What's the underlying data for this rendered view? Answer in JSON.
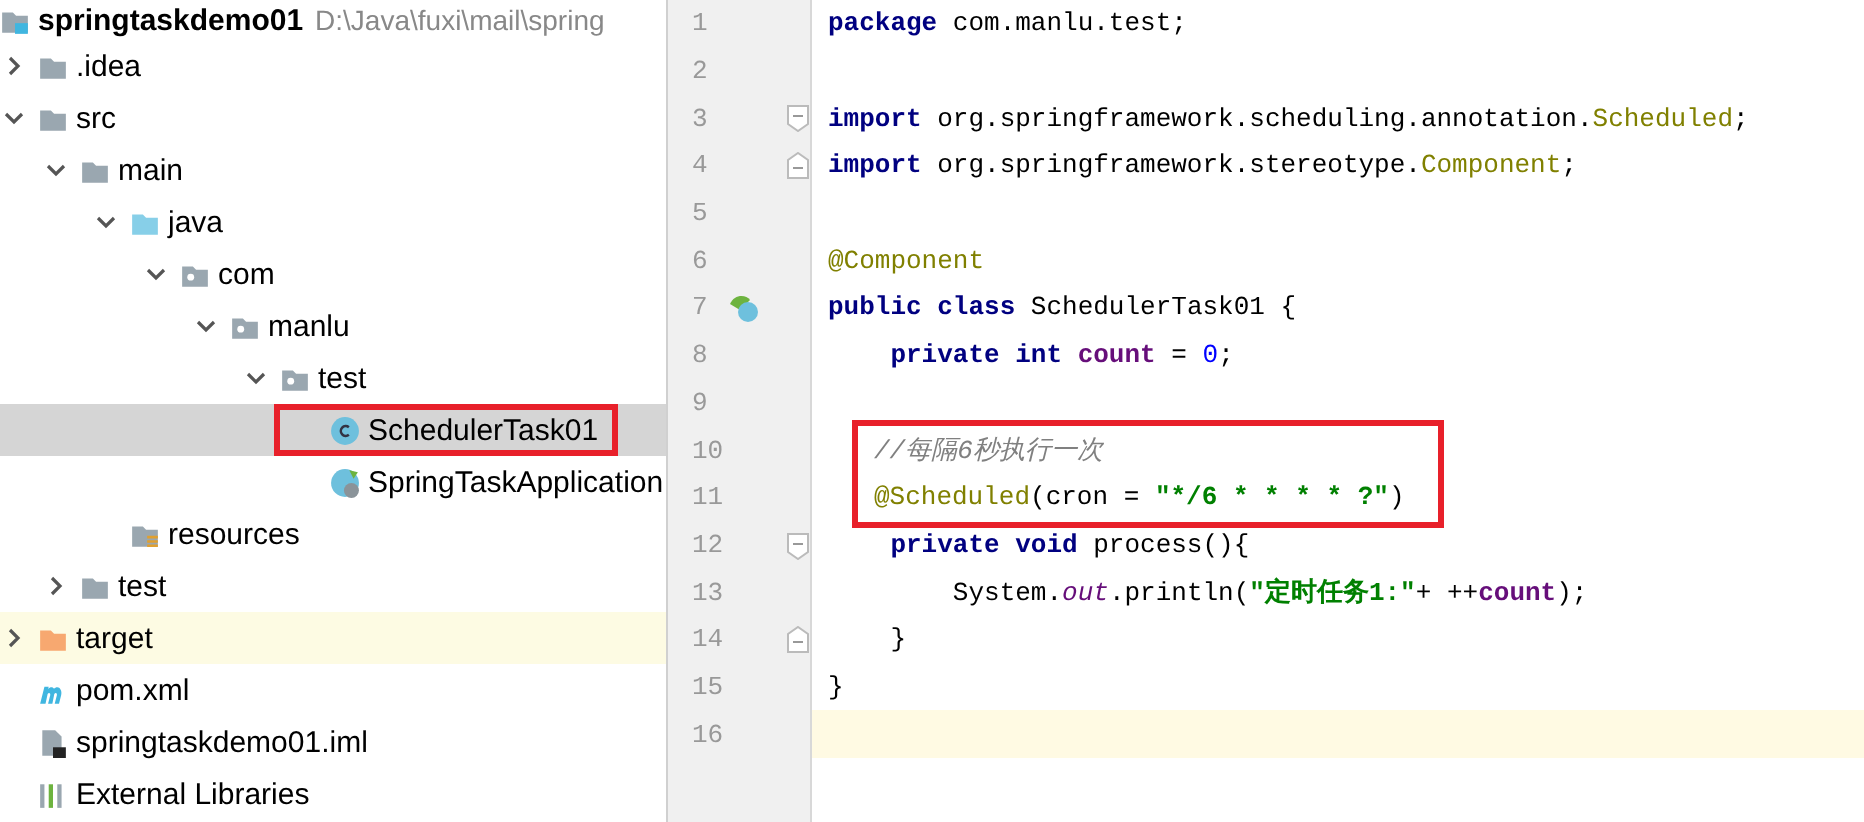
{
  "project_tree": {
    "root": {
      "name": "springtaskdemo01",
      "path": "D:\\Java\\fuxi\\mail\\spring",
      "kind": "module"
    },
    "items": [
      {
        "name": ".idea",
        "kind": "folder",
        "expanded": false,
        "selected": false
      },
      {
        "name": "src",
        "kind": "folder",
        "expanded": true,
        "selected": false,
        "children": [
          {
            "name": "main",
            "kind": "folder",
            "expanded": true,
            "selected": false,
            "children": [
              {
                "name": "java",
                "kind": "source-folder",
                "expanded": true,
                "selected": false,
                "children": [
                  {
                    "name": "com",
                    "kind": "package",
                    "expanded": true,
                    "selected": false,
                    "children": [
                      {
                        "name": "manlu",
                        "kind": "package",
                        "expanded": true,
                        "selected": false,
                        "children": [
                          {
                            "name": "test",
                            "kind": "package",
                            "expanded": true,
                            "selected": false,
                            "children": [
                              {
                                "name": "SchedulerTask01",
                                "kind": "class",
                                "selected": true,
                                "boxed": true
                              },
                              {
                                "name": "SpringTaskApplication",
                                "kind": "spring-class",
                                "selected": false
                              }
                            ]
                          }
                        ]
                      }
                    ]
                  }
                ]
              },
              {
                "name": "resources",
                "kind": "resources",
                "selected": false
              }
            ]
          },
          {
            "name": "test",
            "kind": "folder",
            "expanded": false,
            "selected": false
          }
        ]
      },
      {
        "name": "target",
        "kind": "excluded-folder",
        "expanded": false,
        "selected": false
      },
      {
        "name": "pom.xml",
        "kind": "maven",
        "selected": false
      },
      {
        "name": "springtaskdemo01.iml",
        "kind": "iml",
        "selected": false
      },
      {
        "name": "External Libraries",
        "kind": "libraries",
        "selected": false
      }
    ]
  },
  "editor": {
    "lines": [
      {
        "number": "1",
        "tokens": [
          {
            "kind": "keyword",
            "text": "package"
          },
          {
            "kind": "plain",
            "text": " com.manlu.test;"
          }
        ]
      },
      {
        "number": "2"
      },
      {
        "number": "3",
        "fold_start": true,
        "tokens": [
          {
            "kind": "keyword",
            "text": "import"
          },
          {
            "kind": "plain",
            "text": " org.springframework.scheduling.annotation."
          },
          {
            "kind": "type",
            "text": "Scheduled"
          },
          {
            "kind": "plain",
            "text": ";"
          }
        ]
      },
      {
        "number": "4",
        "fold_end": true,
        "tokens": [
          {
            "kind": "keyword",
            "text": "import"
          },
          {
            "kind": "plain",
            "text": " org.springframework.stereotype."
          },
          {
            "kind": "type",
            "text": "Component"
          },
          {
            "kind": "plain",
            "text": ";"
          }
        ]
      },
      {
        "number": "5"
      },
      {
        "number": "6",
        "tokens": [
          {
            "kind": "annotation",
            "text": "@Component"
          }
        ]
      },
      {
        "number": "7",
        "bean_icon": true,
        "tokens": [
          {
            "kind": "keyword",
            "text": "public class"
          },
          {
            "kind": "plain",
            "text": " SchedulerTask01 {"
          }
        ]
      },
      {
        "number": "8",
        "tokens": [
          {
            "kind": "keyword",
            "text": "    private int"
          },
          {
            "kind": "field",
            "text": " count"
          },
          {
            "kind": "plain",
            "text": " = "
          },
          {
            "kind": "number",
            "text": "0"
          },
          {
            "kind": "plain",
            "text": ";"
          }
        ]
      },
      {
        "number": "9"
      },
      {
        "number": "10",
        "boxed": true,
        "tokens": [
          {
            "kind": "comment",
            "text": "//每隔6秒执行一次"
          }
        ]
      },
      {
        "number": "11",
        "boxed": true,
        "tokens": [
          {
            "kind": "annotation",
            "text": "@Scheduled"
          },
          {
            "kind": "plain",
            "text": "(cron = "
          },
          {
            "kind": "string",
            "text": "\"*/6 * * * * ?\""
          },
          {
            "kind": "plain",
            "text": ")"
          }
        ]
      },
      {
        "number": "12",
        "fold_start": true,
        "tokens": [
          {
            "kind": "keyword",
            "text": "    private void"
          },
          {
            "kind": "plain",
            "text": " process(){"
          }
        ]
      },
      {
        "number": "13",
        "tokens": [
          {
            "kind": "plain",
            "text": "        System."
          },
          {
            "kind": "static",
            "text": "out"
          },
          {
            "kind": "plain",
            "text": ".println("
          },
          {
            "kind": "string",
            "text": "\"定时任务1:\""
          },
          {
            "kind": "plain",
            "text": "+ ++"
          },
          {
            "kind": "field",
            "text": "count"
          },
          {
            "kind": "plain",
            "text": ");"
          }
        ]
      },
      {
        "number": "14",
        "fold_end": true,
        "tokens": [
          {
            "kind": "plain",
            "text": "    }"
          }
        ]
      },
      {
        "number": "15",
        "tokens": [
          {
            "kind": "plain",
            "text": "}"
          }
        ]
      },
      {
        "number": "16",
        "current": true
      }
    ]
  }
}
